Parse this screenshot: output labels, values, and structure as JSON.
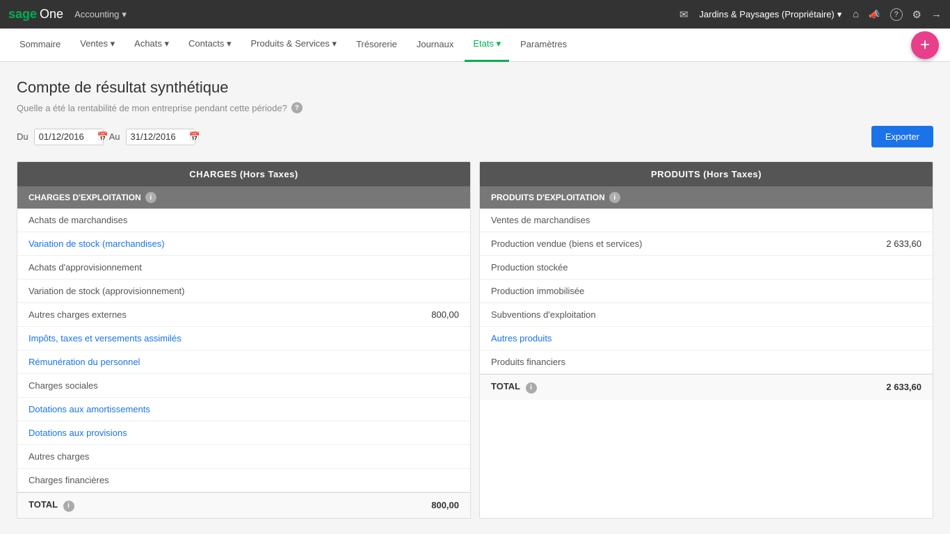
{
  "topnav": {
    "logo_sage": "sage",
    "logo_one": "One",
    "accounting_label": "Accounting",
    "dropdown_arrow": "▾",
    "company": "Jardins & Paysages (Propriétaire)",
    "company_arrow": "▾",
    "icons": {
      "email": "✉",
      "home": "⌂",
      "megaphone": "📢",
      "help": "?",
      "settings": "⚙",
      "logout": "⎋"
    }
  },
  "mainnav": {
    "items": [
      {
        "label": "Sommaire",
        "active": false
      },
      {
        "label": "Ventes",
        "active": false,
        "has_arrow": true
      },
      {
        "label": "Achats",
        "active": false,
        "has_arrow": true
      },
      {
        "label": "Contacts",
        "active": false,
        "has_arrow": true
      },
      {
        "label": "Produits & Services",
        "active": false,
        "has_arrow": true
      },
      {
        "label": "Trésorerie",
        "active": false
      },
      {
        "label": "Journaux",
        "active": false
      },
      {
        "label": "Etats",
        "active": true,
        "has_arrow": true
      },
      {
        "label": "Paramètres",
        "active": false
      }
    ],
    "add_label": "+"
  },
  "page": {
    "title": "Compte de résultat synthétique",
    "subtitle": "Quelle a été la rentabilité de mon entreprise pendant cette période?",
    "date_from_label": "Du",
    "date_from": "01/12/2016",
    "date_to_label": "Au",
    "date_to": "31/12/2016",
    "export_label": "Exporter"
  },
  "charges_table": {
    "header": "CHARGES (Hors Taxes)",
    "section_header": "CHARGES D'EXPLOITATION",
    "rows": [
      {
        "label": "Achats de marchandises",
        "amount": "",
        "link": false
      },
      {
        "label": "Variation de stock (marchandises)",
        "amount": "",
        "link": true
      },
      {
        "label": "Achats d'approvisionnement",
        "amount": "",
        "link": false
      },
      {
        "label": "Variation de stock (approvisionnement)",
        "amount": "",
        "link": false
      },
      {
        "label": "Autres charges externes",
        "amount": "800,00",
        "link": false
      },
      {
        "label": "Impôts, taxes et versements assimilés",
        "amount": "",
        "link": true
      },
      {
        "label": "Rémunération du personnel",
        "amount": "",
        "link": true
      },
      {
        "label": "Charges sociales",
        "amount": "",
        "link": false
      },
      {
        "label": "Dotations aux amortissements",
        "amount": "",
        "link": true
      },
      {
        "label": "Dotations aux provisions",
        "amount": "",
        "link": true
      },
      {
        "label": "Autres charges",
        "amount": "",
        "link": false
      },
      {
        "label": "Charges financières",
        "amount": "",
        "link": false
      }
    ],
    "total_label": "TOTAL",
    "total_amount": "800,00"
  },
  "produits_table": {
    "header": "PRODUITS (Hors Taxes)",
    "section_header": "PRODUITS D'EXPLOITATION",
    "rows": [
      {
        "label": "Ventes de marchandises",
        "amount": "",
        "link": false
      },
      {
        "label": "Production vendue (biens et services)",
        "amount": "2 633,60",
        "link": false
      },
      {
        "label": "Production stockée",
        "amount": "",
        "link": false
      },
      {
        "label": "Production immobilisée",
        "amount": "",
        "link": false
      },
      {
        "label": "Subventions d'exploitation",
        "amount": "",
        "link": false
      },
      {
        "label": "Autres produits",
        "amount": "",
        "link": true
      },
      {
        "label": "Produits financiers",
        "amount": "",
        "link": false
      }
    ],
    "total_label": "TOTAL",
    "total_amount": "2 633,60"
  }
}
